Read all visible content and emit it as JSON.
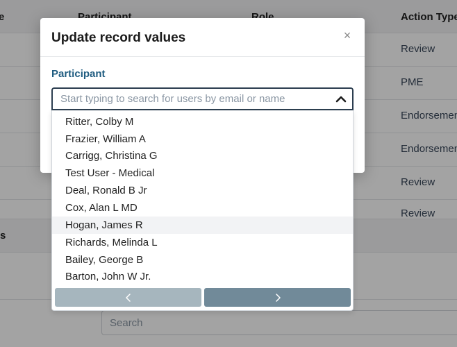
{
  "background": {
    "table_headers": [
      {
        "key": "col1",
        "text": "e"
      },
      {
        "key": "col2",
        "text": "Participant"
      },
      {
        "key": "col3",
        "text": "Role"
      },
      {
        "key": "col4",
        "text": "Action Type"
      }
    ],
    "rows": [
      {
        "action_type": "Review"
      },
      {
        "action_type": "PME"
      },
      {
        "action_type": "Endorsement"
      },
      {
        "action_type": "Endorsement"
      },
      {
        "action_type": "Review"
      },
      {
        "action_type": "Review"
      }
    ],
    "section_label": "s",
    "search_placeholder": "Search"
  },
  "modal": {
    "title": "Update record values",
    "close_symbol": "×",
    "participant_label": "Participant",
    "participant_placeholder": "Start typing to search for users by email or name",
    "options": [
      "Ritter, Colby M",
      "Frazier, William A",
      "Carrigg, Christina G",
      "Test User - Medical",
      "Deal, Ronald B Jr",
      "Cox, Alan L MD",
      "Hogan, James R",
      "Richards, Melinda L",
      "Bailey, George B",
      "Barton, John W Jr."
    ],
    "highlighted_option_index": 6,
    "pager": {
      "prev_icon": "chevron-left-icon",
      "next_icon": "chevron-right-icon",
      "prev_color": "#a6b6be",
      "next_color": "#718a99"
    }
  },
  "colors": {
    "label_accent": "#1f5c80",
    "select_border": "#2c3e50"
  }
}
